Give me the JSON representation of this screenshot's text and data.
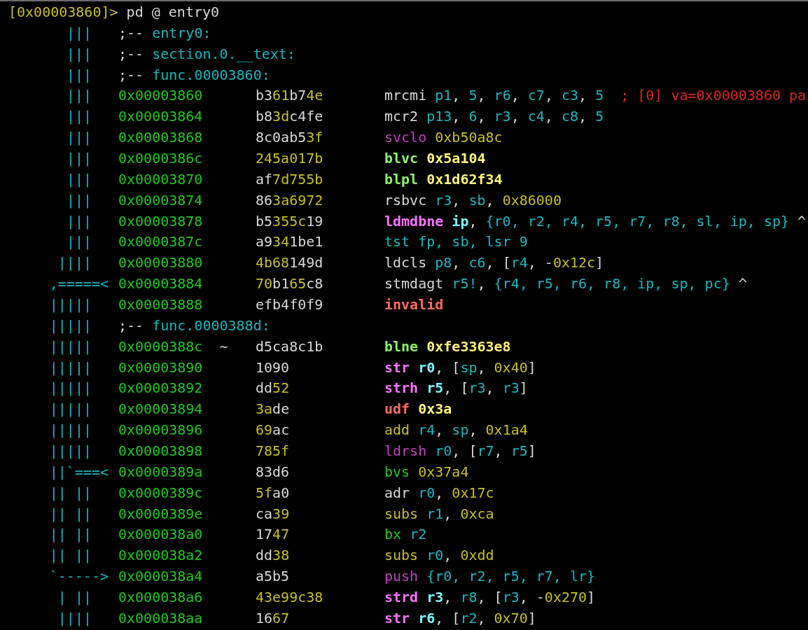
{
  "prompt": {
    "address": "[0x00003860]>",
    "command": "pd @ entry0"
  },
  "rows": [
    {
      "kind": "label",
      "arrows": {
        "text": "|||",
        "kind": "bars"
      },
      "marker": ";--",
      "label": "entry0:"
    },
    {
      "kind": "label",
      "arrows": {
        "text": "|||",
        "kind": "bars"
      },
      "marker": ";--",
      "label": "section.0.__text:"
    },
    {
      "kind": "label",
      "arrows": {
        "text": "|||",
        "kind": "bars"
      },
      "marker": ";--",
      "label": "func.00003860:"
    },
    {
      "kind": "instruction",
      "arrows": {
        "text": "|||",
        "kind": "bars"
      },
      "address": "0x00003860",
      "bytes": [
        {
          "t": "b3",
          "color": "#d8d8d8"
        },
        {
          "t": "61",
          "color": "#c8bf2b"
        },
        {
          "t": "b7",
          "color": "#d8d8d8"
        },
        {
          "t": "4e",
          "color": "#c8bf2b"
        }
      ],
      "mnemonic": {
        "t": "mrcmi",
        "color": "#d8d8d8",
        "bold": false
      },
      "operands": [
        {
          "t": "p1",
          "color": "#1ab6c0",
          "bold": false
        },
        {
          "t": ", ",
          "color": "#d8d8d8",
          "bold": false
        },
        {
          "t": "5",
          "color": "#1ab6c0",
          "bold": false
        },
        {
          "t": ", ",
          "color": "#d8d8d8",
          "bold": false
        },
        {
          "t": "r6",
          "color": "#1ab6c0",
          "bold": false
        },
        {
          "t": ", ",
          "color": "#d8d8d8",
          "bold": false
        },
        {
          "t": "c7",
          "color": "#1ab6c0",
          "bold": false
        },
        {
          "t": ", ",
          "color": "#d8d8d8",
          "bold": false
        },
        {
          "t": "c3",
          "color": "#1ab6c0",
          "bold": false
        },
        {
          "t": ", ",
          "color": "#d8d8d8",
          "bold": false
        },
        {
          "t": "5",
          "color": "#1ab6c0",
          "bold": false
        }
      ],
      "comment": "; [0] va=0x00003860 pa"
    },
    {
      "kind": "instruction",
      "arrows": {
        "text": "|||",
        "kind": "bars"
      },
      "address": "0x00003864",
      "bytes": [
        {
          "t": "b8",
          "color": "#d8d8d8"
        },
        {
          "t": "3d",
          "color": "#c8bf2b"
        },
        {
          "t": "c4fe",
          "color": "#d8d8d8"
        }
      ],
      "mnemonic": {
        "t": "mcr2",
        "color": "#d8d8d8",
        "bold": false
      },
      "operands": [
        {
          "t": "p13",
          "color": "#1ab6c0",
          "bold": false
        },
        {
          "t": ", ",
          "color": "#d8d8d8",
          "bold": false
        },
        {
          "t": "6",
          "color": "#1ab6c0",
          "bold": false
        },
        {
          "t": ", ",
          "color": "#d8d8d8",
          "bold": false
        },
        {
          "t": "r3",
          "color": "#1ab6c0",
          "bold": false
        },
        {
          "t": ", ",
          "color": "#d8d8d8",
          "bold": false
        },
        {
          "t": "c4",
          "color": "#1ab6c0",
          "bold": false
        },
        {
          "t": ", ",
          "color": "#d8d8d8",
          "bold": false
        },
        {
          "t": "c8",
          "color": "#1ab6c0",
          "bold": false
        },
        {
          "t": ", ",
          "color": "#d8d8d8",
          "bold": false
        },
        {
          "t": "5",
          "color": "#1ab6c0",
          "bold": false
        }
      ]
    },
    {
      "kind": "instruction",
      "arrows": {
        "text": "|||",
        "kind": "bars"
      },
      "address": "0x00003868",
      "bytes": [
        {
          "t": "8c0ab5",
          "color": "#d8d8d8"
        },
        {
          "t": "3f",
          "color": "#c8bf2b"
        }
      ],
      "mnemonic": {
        "t": "svclo",
        "color": "#c23fc2",
        "bold": false
      },
      "operands": [
        {
          "t": "0xb50a8c",
          "color": "#c8bf2b",
          "bold": false
        }
      ]
    },
    {
      "kind": "instruction",
      "arrows": {
        "text": "|||",
        "kind": "bars"
      },
      "address": "0x0000386c",
      "bytes": [
        {
          "t": "245a017b",
          "color": "#c8bf2b"
        }
      ],
      "mnemonic": {
        "t": "blvc",
        "color": "#8cf46c",
        "bold": true
      },
      "operands": [
        {
          "t": "0x5a104",
          "color": "#fff47c",
          "bold": true
        }
      ]
    },
    {
      "kind": "instruction",
      "arrows": {
        "text": "|||",
        "kind": "bars"
      },
      "address": "0x00003870",
      "bytes": [
        {
          "t": "af",
          "color": "#d8d8d8"
        },
        {
          "t": "7d755b",
          "color": "#c8bf2b"
        }
      ],
      "mnemonic": {
        "t": "blpl",
        "color": "#8cf46c",
        "bold": true
      },
      "operands": [
        {
          "t": "0x1d62f34",
          "color": "#fff47c",
          "bold": true
        }
      ]
    },
    {
      "kind": "instruction",
      "arrows": {
        "text": "|||",
        "kind": "bars"
      },
      "address": "0x00003874",
      "bytes": [
        {
          "t": "86",
          "color": "#d8d8d8"
        },
        {
          "t": "3a6972",
          "color": "#c8bf2b"
        }
      ],
      "mnemonic": {
        "t": "rsbvc",
        "color": "#d8d8d8",
        "bold": false
      },
      "operands": [
        {
          "t": "r3",
          "color": "#1ab6c0",
          "bold": false
        },
        {
          "t": ", ",
          "color": "#d8d8d8",
          "bold": false
        },
        {
          "t": "sb",
          "color": "#1ab6c0",
          "bold": false
        },
        {
          "t": ", ",
          "color": "#d8d8d8",
          "bold": false
        },
        {
          "t": "0x86000",
          "color": "#c8bf2b",
          "bold": false
        }
      ]
    },
    {
      "kind": "instruction",
      "arrows": {
        "text": "|||",
        "kind": "bars"
      },
      "address": "0x00003878",
      "bytes": [
        {
          "t": "b5",
          "color": "#d8d8d8"
        },
        {
          "t": "355c",
          "color": "#c8bf2b"
        },
        {
          "t": "19",
          "color": "#d8d8d8"
        }
      ],
      "mnemonic": {
        "t": "ldmdbne",
        "color": "#ff72ff",
        "bold": true
      },
      "operands": [
        {
          "t": "ip",
          "color": "#7ef6ff",
          "bold": true
        },
        {
          "t": ", ",
          "color": "#d8d8d8",
          "bold": false
        },
        {
          "t": "{r0, r2, r4, r5, r7, r8, sl, ip, sp}",
          "color": "#1ab6c0",
          "bold": false
        },
        {
          "t": " ^",
          "color": "#d8d8d8",
          "bold": false
        }
      ]
    },
    {
      "kind": "instruction",
      "arrows": {
        "text": "|||",
        "kind": "bars"
      },
      "address": "0x0000387c",
      "bytes": [
        {
          "t": "a9",
          "color": "#d8d8d8"
        },
        {
          "t": "34",
          "color": "#c8bf2b"
        },
        {
          "t": "1be1",
          "color": "#d8d8d8"
        }
      ],
      "mnemonic": {
        "t": "tst",
        "color": "#1ab6c0",
        "bold": false
      },
      "operands": [
        {
          "t": "fp, sb, lsr 9",
          "color": "#1ab6c0",
          "bold": false
        }
      ]
    },
    {
      "kind": "instruction",
      "arrows": {
        "text": "||||",
        "kind": "bars"
      },
      "address": "0x00003880",
      "bytes": [
        {
          "t": "4b68",
          "color": "#c8bf2b"
        },
        {
          "t": "149d",
          "color": "#d8d8d8"
        }
      ],
      "mnemonic": {
        "t": "ldcls",
        "color": "#d8d8d8",
        "bold": false
      },
      "operands": [
        {
          "t": "p8",
          "color": "#1ab6c0",
          "bold": false
        },
        {
          "t": ", ",
          "color": "#d8d8d8",
          "bold": false
        },
        {
          "t": "c6",
          "color": "#1ab6c0",
          "bold": false
        },
        {
          "t": ", [",
          "color": "#d8d8d8",
          "bold": false
        },
        {
          "t": "r4",
          "color": "#1ab6c0",
          "bold": false
        },
        {
          "t": ", -",
          "color": "#d8d8d8",
          "bold": false
        },
        {
          "t": "0x12c",
          "color": "#c8bf2b",
          "bold": false
        },
        {
          "t": "]",
          "color": "#d8d8d8",
          "bold": false
        }
      ]
    },
    {
      "kind": "instruction",
      "arrows": {
        "text": ",=====<",
        "kind": "jump"
      },
      "address": "0x00003884",
      "bytes": [
        {
          "t": "70",
          "color": "#c8bf2b"
        },
        {
          "t": "b1",
          "color": "#d8d8d8"
        },
        {
          "t": "65",
          "color": "#c8bf2b"
        },
        {
          "t": "c8",
          "color": "#d8d8d8"
        }
      ],
      "mnemonic": {
        "t": "stmdagt",
        "color": "#d8d8d8",
        "bold": false
      },
      "operands": [
        {
          "t": "r5!",
          "color": "#1ab6c0",
          "bold": false
        },
        {
          "t": ", ",
          "color": "#d8d8d8",
          "bold": false
        },
        {
          "t": "{r4, r5, r6, r8, ip, sp, pc}",
          "color": "#1ab6c0",
          "bold": false
        },
        {
          "t": " ^",
          "color": "#d8d8d8",
          "bold": false
        }
      ]
    },
    {
      "kind": "instruction",
      "arrows": {
        "text": "|||||",
        "kind": "bars"
      },
      "address": "0x00003888",
      "bytes": [
        {
          "t": "efb4f0f9",
          "color": "#d8d8d8"
        }
      ],
      "mnemonic": {
        "t": "invalid",
        "color": "#ff6b5d",
        "bold": true
      },
      "operands": []
    },
    {
      "kind": "label",
      "arrows": {
        "text": "|||||",
        "kind": "bars"
      },
      "marker": ";--",
      "label": "func.0000388d:"
    },
    {
      "kind": "instruction",
      "arrows": {
        "text": "|||||",
        "kind": "bars"
      },
      "address": "0x0000388c",
      "flag": "~",
      "bytes": [
        {
          "t": "d5ca8c1b",
          "color": "#d8d8d8"
        }
      ],
      "mnemonic": {
        "t": "blne",
        "color": "#8cf46c",
        "bold": true
      },
      "operands": [
        {
          "t": "0xfe3363e8",
          "color": "#fff47c",
          "bold": true
        }
      ]
    },
    {
      "kind": "instruction",
      "arrows": {
        "text": "|||||",
        "kind": "bars"
      },
      "address": "0x00003890",
      "bytes": [
        {
          "t": "1090",
          "color": "#d8d8d8"
        }
      ],
      "mnemonic": {
        "t": "str",
        "color": "#ff72ff",
        "bold": true
      },
      "operands": [
        {
          "t": "r0",
          "color": "#7ef6ff",
          "bold": true
        },
        {
          "t": ", [",
          "color": "#d8d8d8",
          "bold": false
        },
        {
          "t": "sp",
          "color": "#1ab6c0",
          "bold": false
        },
        {
          "t": ", ",
          "color": "#d8d8d8",
          "bold": false
        },
        {
          "t": "0x40",
          "color": "#c8bf2b",
          "bold": false
        },
        {
          "t": "]",
          "color": "#d8d8d8",
          "bold": false
        }
      ]
    },
    {
      "kind": "instruction",
      "arrows": {
        "text": "|||||",
        "kind": "bars"
      },
      "address": "0x00003892",
      "bytes": [
        {
          "t": "dd",
          "color": "#d8d8d8"
        },
        {
          "t": "52",
          "color": "#c8bf2b"
        }
      ],
      "mnemonic": {
        "t": "strh",
        "color": "#ff72ff",
        "bold": true
      },
      "operands": [
        {
          "t": "r5",
          "color": "#7ef6ff",
          "bold": true
        },
        {
          "t": ", [",
          "color": "#d8d8d8",
          "bold": false
        },
        {
          "t": "r3",
          "color": "#1ab6c0",
          "bold": false
        },
        {
          "t": ", ",
          "color": "#d8d8d8",
          "bold": false
        },
        {
          "t": "r3",
          "color": "#1ab6c0",
          "bold": false
        },
        {
          "t": "]",
          "color": "#d8d8d8",
          "bold": false
        }
      ]
    },
    {
      "kind": "instruction",
      "arrows": {
        "text": "|||||",
        "kind": "bars"
      },
      "address": "0x00003894",
      "bytes": [
        {
          "t": "3a",
          "color": "#c8bf2b"
        },
        {
          "t": "de",
          "color": "#d8d8d8"
        }
      ],
      "mnemonic": {
        "t": "udf",
        "color": "#ff6b5d",
        "bold": true
      },
      "operands": [
        {
          "t": "0x3a",
          "color": "#fff47c",
          "bold": true
        }
      ]
    },
    {
      "kind": "instruction",
      "arrows": {
        "text": "|||||",
        "kind": "bars"
      },
      "address": "0x00003896",
      "bytes": [
        {
          "t": "69",
          "color": "#c8bf2b"
        },
        {
          "t": "ac",
          "color": "#d8d8d8"
        }
      ],
      "mnemonic": {
        "t": "add",
        "color": "#c8bf2b",
        "bold": false
      },
      "operands": [
        {
          "t": "r4",
          "color": "#1ab6c0",
          "bold": false
        },
        {
          "t": ", ",
          "color": "#d8d8d8",
          "bold": false
        },
        {
          "t": "sp",
          "color": "#1ab6c0",
          "bold": false
        },
        {
          "t": ", ",
          "color": "#d8d8d8",
          "bold": false
        },
        {
          "t": "0x1a4",
          "color": "#c8bf2b",
          "bold": false
        }
      ]
    },
    {
      "kind": "instruction",
      "arrows": {
        "text": "|||||",
        "kind": "bars"
      },
      "address": "0x00003898",
      "bytes": [
        {
          "t": "785f",
          "color": "#c8bf2b"
        }
      ],
      "mnemonic": {
        "t": "ldrsh",
        "color": "#c23fc2",
        "bold": false
      },
      "operands": [
        {
          "t": "r0",
          "color": "#1ab6c0",
          "bold": false
        },
        {
          "t": ", [",
          "color": "#d8d8d8",
          "bold": false
        },
        {
          "t": "r7",
          "color": "#1ab6c0",
          "bold": false
        },
        {
          "t": ", ",
          "color": "#d8d8d8",
          "bold": false
        },
        {
          "t": "r5",
          "color": "#1ab6c0",
          "bold": false
        },
        {
          "t": "]",
          "color": "#d8d8d8",
          "bold": false
        }
      ]
    },
    {
      "kind": "instruction",
      "arrows": {
        "text": "||`===<",
        "kind": "jump"
      },
      "address": "0x0000389a",
      "bytes": [
        {
          "t": "83d6",
          "color": "#d8d8d8"
        }
      ],
      "mnemonic": {
        "t": "bvs",
        "color": "#22c622",
        "bold": false
      },
      "operands": [
        {
          "t": "0x37a4",
          "color": "#c8bf2b",
          "bold": false
        }
      ]
    },
    {
      "kind": "instruction",
      "arrows": {
        "text": "|| ||",
        "kind": "bars"
      },
      "address": "0x0000389c",
      "bytes": [
        {
          "t": "5f",
          "color": "#c8bf2b"
        },
        {
          "t": "a0",
          "color": "#d8d8d8"
        }
      ],
      "mnemonic": {
        "t": "adr",
        "color": "#d8d8d8",
        "bold": false
      },
      "operands": [
        {
          "t": "r0",
          "color": "#1ab6c0",
          "bold": false
        },
        {
          "t": ", ",
          "color": "#d8d8d8",
          "bold": false
        },
        {
          "t": "0x17c",
          "color": "#c8bf2b",
          "bold": false
        }
      ]
    },
    {
      "kind": "instruction",
      "arrows": {
        "text": "|| ||",
        "kind": "bars"
      },
      "address": "0x0000389e",
      "bytes": [
        {
          "t": "ca",
          "color": "#d8d8d8"
        },
        {
          "t": "39",
          "color": "#c8bf2b"
        }
      ],
      "mnemonic": {
        "t": "subs",
        "color": "#c8bf2b",
        "bold": false
      },
      "operands": [
        {
          "t": "r1",
          "color": "#1ab6c0",
          "bold": false
        },
        {
          "t": ", ",
          "color": "#d8d8d8",
          "bold": false
        },
        {
          "t": "0xca",
          "color": "#c8bf2b",
          "bold": false
        }
      ]
    },
    {
      "kind": "instruction",
      "arrows": {
        "text": "|| ||",
        "kind": "bars"
      },
      "address": "0x000038a0",
      "bytes": [
        {
          "t": "17",
          "color": "#d8d8d8"
        },
        {
          "t": "47",
          "color": "#c8bf2b"
        }
      ],
      "mnemonic": {
        "t": "bx",
        "color": "#22c622",
        "bold": false
      },
      "operands": [
        {
          "t": "r2",
          "color": "#1ab6c0",
          "bold": false
        }
      ]
    },
    {
      "kind": "instruction",
      "arrows": {
        "text": "|| ||",
        "kind": "bars"
      },
      "address": "0x000038a2",
      "bytes": [
        {
          "t": "dd",
          "color": "#d8d8d8"
        },
        {
          "t": "38",
          "color": "#c8bf2b"
        }
      ],
      "mnemonic": {
        "t": "subs",
        "color": "#c8bf2b",
        "bold": false
      },
      "operands": [
        {
          "t": "r0",
          "color": "#1ab6c0",
          "bold": false
        },
        {
          "t": ", ",
          "color": "#d8d8d8",
          "bold": false
        },
        {
          "t": "0xdd",
          "color": "#c8bf2b",
          "bold": false
        }
      ]
    },
    {
      "kind": "instruction",
      "arrows": {
        "text": "`----->",
        "kind": "jump"
      },
      "address": "0x000038a4",
      "bytes": [
        {
          "t": "a5b5",
          "color": "#d8d8d8"
        }
      ],
      "mnemonic": {
        "t": "push",
        "color": "#c23fc2",
        "bold": false
      },
      "operands": [
        {
          "t": "{r0, r2, r5, r7, lr}",
          "color": "#1ab6c0",
          "bold": false
        }
      ]
    },
    {
      "kind": "instruction",
      "arrows": {
        "text": "| ||",
        "kind": "bars"
      },
      "address": "0x000038a6",
      "bytes": [
        {
          "t": "43e99c38",
          "color": "#c8bf2b"
        }
      ],
      "mnemonic": {
        "t": "strd",
        "color": "#ff72ff",
        "bold": true
      },
      "operands": [
        {
          "t": "r3",
          "color": "#7ef6ff",
          "bold": true
        },
        {
          "t": ", ",
          "color": "#d8d8d8",
          "bold": false
        },
        {
          "t": "r8",
          "color": "#1ab6c0",
          "bold": false
        },
        {
          "t": ", [",
          "color": "#d8d8d8",
          "bold": false
        },
        {
          "t": "r3",
          "color": "#1ab6c0",
          "bold": false
        },
        {
          "t": ", -",
          "color": "#d8d8d8",
          "bold": false
        },
        {
          "t": "0x270",
          "color": "#c8bf2b",
          "bold": false
        },
        {
          "t": "]",
          "color": "#d8d8d8",
          "bold": false
        }
      ]
    },
    {
      "kind": "instruction",
      "arrows": {
        "text": "||||",
        "kind": "bars"
      },
      "address": "0x000038aa",
      "bytes": [
        {
          "t": "16",
          "color": "#d8d8d8"
        },
        {
          "t": "67",
          "color": "#c8bf2b"
        }
      ],
      "mnemonic": {
        "t": "str",
        "color": "#ff72ff",
        "bold": true
      },
      "operands": [
        {
          "t": "r6",
          "color": "#7ef6ff",
          "bold": true
        },
        {
          "t": ", [",
          "color": "#d8d8d8",
          "bold": false
        },
        {
          "t": "r2",
          "color": "#1ab6c0",
          "bold": false
        },
        {
          "t": ", ",
          "color": "#d8d8d8",
          "bold": false
        },
        {
          "t": "0x70",
          "color": "#c8bf2b",
          "bold": false
        },
        {
          "t": "]",
          "color": "#d8d8d8",
          "bold": false
        }
      ]
    }
  ]
}
